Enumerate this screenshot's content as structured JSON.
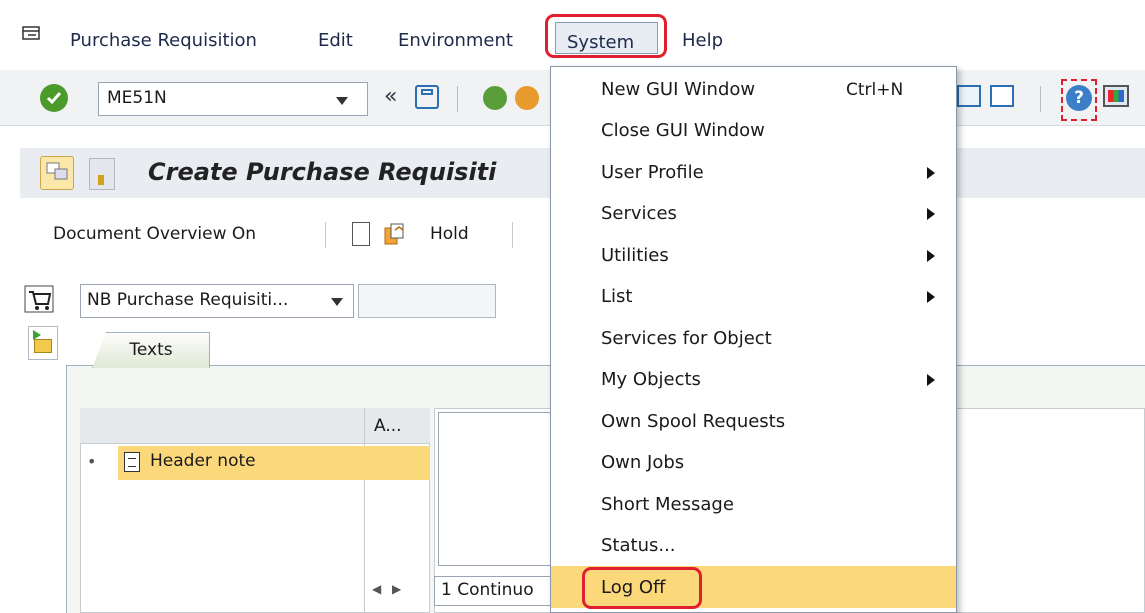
{
  "menubar": {
    "items": [
      {
        "label": "Purchase Requisition",
        "mnemonic": "P"
      },
      {
        "label": "Edit",
        "mnemonic": "E"
      },
      {
        "label": "Environment",
        "mnemonic": "v"
      },
      {
        "label": "System",
        "mnemonic": "y"
      },
      {
        "label": "Help",
        "mnemonic": "H"
      }
    ]
  },
  "toolbar": {
    "command_value": "ME51N",
    "back_label": "«"
  },
  "title": "Create Purchase Requisiti",
  "app_toolbar": {
    "doc_overview_label": "Document Overview On",
    "hold_label": "Hold"
  },
  "header": {
    "doc_type_value": "NB Purchase Requisiti...",
    "doc_number_value": ""
  },
  "tabs": [
    {
      "label": "Texts"
    }
  ],
  "texts_panel": {
    "column2_header": "A...",
    "tree_items": [
      {
        "label": "Header note"
      }
    ],
    "line_indicator": "1 Continuo"
  },
  "system_menu": {
    "items": [
      {
        "label": "New GUI Window",
        "shortcut": "Ctrl+N",
        "submenu": false
      },
      {
        "label": "Close GUI Window",
        "submenu": false
      },
      {
        "label": "User Profile",
        "submenu": true
      },
      {
        "label": "Services",
        "submenu": true
      },
      {
        "label": "Utilities",
        "submenu": true
      },
      {
        "label": "List",
        "submenu": true
      },
      {
        "label": "Services for Object",
        "submenu": false
      },
      {
        "label": "My Objects",
        "submenu": true
      },
      {
        "label": "Own Spool Requests",
        "submenu": false
      },
      {
        "label": "Own Jobs",
        "submenu": false
      },
      {
        "label": "Short Message",
        "submenu": false
      },
      {
        "label": "Status...",
        "submenu": false
      },
      {
        "label": "Log Off",
        "submenu": false,
        "highlighted": true
      }
    ]
  },
  "colors": {
    "highlight_red": "#e1202d",
    "hover_yellow": "#fbd87a",
    "ok_green": "#4c9a2a"
  }
}
